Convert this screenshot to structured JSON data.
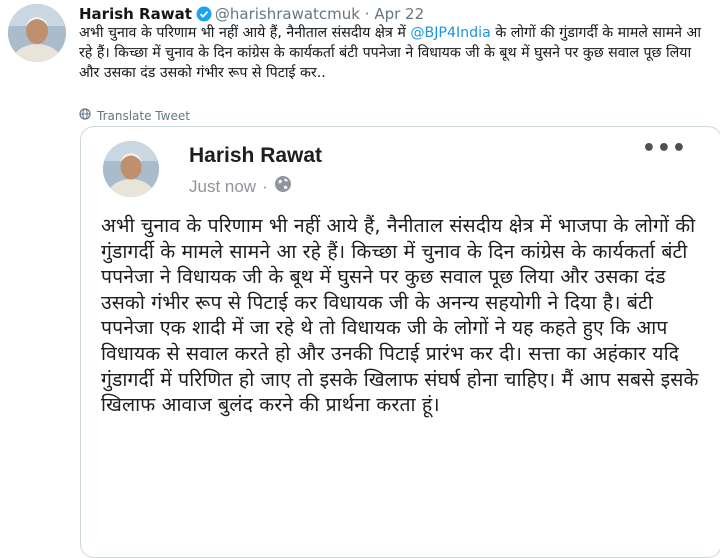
{
  "tweet": {
    "author_name": "Harish Rawat",
    "handle": "@harishrawatcmuk",
    "separator": "·",
    "date": "Apr 22",
    "text_part1": "अभी चुनाव के परिणाम भी नहीं आये हैं, नैनीताल संसदीय क्षेत्र में ",
    "mention": "@BJP4India",
    "text_part2": " के लोगों की गुंडागर्दी के मामले सामने आ रहे हैं। किच्छा में चुनाव के दिन कांग्रेस के कार्यकर्ता बंटी पपनेजा ने विधायक जी के बूथ में घुसने पर कुछ सवाल पूछ लिया और उसका दंड उसको गंभीर रूप से पिटाई कर..",
    "translate_label": "Translate Tweet"
  },
  "embedded_post": {
    "author_name": "Harish Rawat",
    "time": "Just now",
    "separator": "·",
    "more_label": "•••",
    "text": "अभी चुनाव के परिणाम भी नहीं आये हैं, नैनीताल संसदीय क्षेत्र में भाजपा के लोगों की गुंडागर्दी के मामले सामने आ रहे हैं। किच्छा में चुनाव के दिन कांग्रेस के कार्यकर्ता बंटी पपनेजा ने विधायक जी के बूथ में घुसने पर कुछ सवाल पूछ लिया और उसका दंड उसको गंभीर रूप से पिटाई कर विधायक जी के अनन्य सहयोगी ने दिया है। बंटी पपनेजा एक शादी में जा रहे थे तो विधायक जी के लोगों ने यह कहते हुए कि आप विधायक से सवाल करते हो और उनकी पिटाई प्रारंभ कर दी। सत्ता का अहंकार यदि गुंडागर्दी में परिणित हो जाए तो इसके खिलाफ संघर्ष होना चाहिए। मैं आप सबसे इसके खिलाफ आवाज बुलंद करने की प्रार्थना करता हूं।"
  },
  "colors": {
    "link": "#1b95e0",
    "verified": "#1da1f2",
    "muted": "#657786",
    "border": "#ccd6dd"
  },
  "icons": {
    "verified": "verified-badge-icon",
    "globe": "globe-icon",
    "translate": "translate-icon",
    "more": "more-options-icon"
  }
}
